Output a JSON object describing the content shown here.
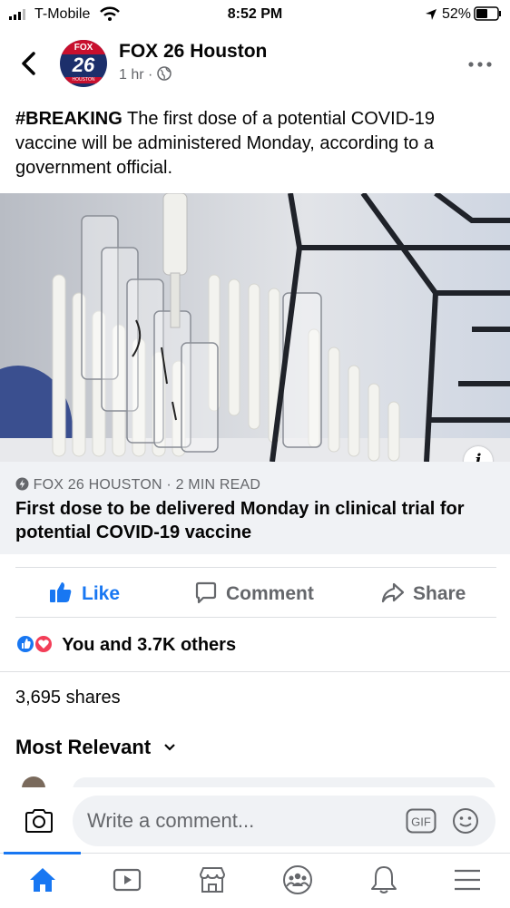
{
  "status_bar": {
    "carrier": "T-Mobile",
    "time": "8:52 PM",
    "battery": "52%"
  },
  "post": {
    "page_name": "FOX 26 Houston",
    "avatar": {
      "top": "FOX",
      "number": "26",
      "city": "HOUSTON"
    },
    "time": "1 hr",
    "separator": "·",
    "audience_icon": "globe-icon",
    "hashtag": "#BREAKING",
    "text": " The first dose of a potential COVID-19 vaccine will be administered Monday, according to a government official."
  },
  "link_card": {
    "source": "FOX 26 HOUSTON · 2 MIN READ",
    "title": "First dose to be delivered Monday in clinical trial for potential COVID-19 vaccine",
    "info_label": "i"
  },
  "actions": {
    "like": "Like",
    "comment": "Comment",
    "share": "Share"
  },
  "reactions_text": "You and 3.7K others",
  "shares_text": "3,695 shares",
  "sort_label": "Most Relevant",
  "comment_bar": {
    "placeholder": "Write a comment..."
  },
  "tabs": [
    "home-icon",
    "video-icon",
    "marketplace-icon",
    "groups-icon",
    "notifications-icon",
    "menu-icon"
  ],
  "colors": {
    "brand_blue": "#1877f2",
    "love_red": "#f33e58",
    "fox_red": "#c8102e",
    "fox_navy": "#1c2f6b"
  }
}
